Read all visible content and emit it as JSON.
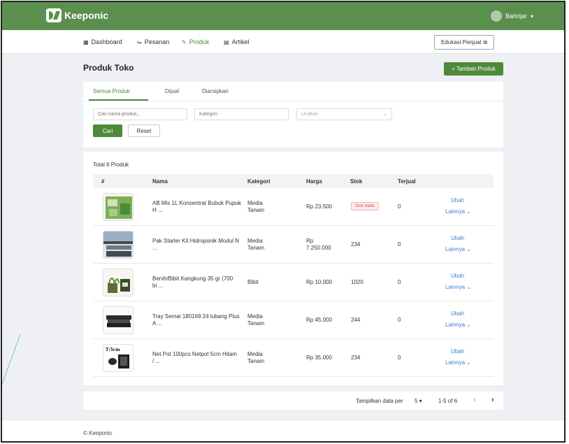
{
  "app": {
    "brand": "Keeponic",
    "user_name": "Bahrijar",
    "user_caret": "▾"
  },
  "nav": {
    "items": [
      {
        "label": "Dashboard",
        "icon": "dashboard-icon",
        "glyph": "▦"
      },
      {
        "label": "Pesanan",
        "icon": "orders-icon",
        "glyph": "⇋"
      },
      {
        "label": "Produk",
        "icon": "pencil-icon",
        "glyph": "✎"
      },
      {
        "label": "Artikel",
        "icon": "article-icon",
        "glyph": "▤"
      }
    ],
    "education_button": "Edukasi Penjual",
    "external_glyph": "⧉"
  },
  "page": {
    "title": "Produk Toko",
    "add_button": "+ Tambah Produk"
  },
  "tabs": [
    "Semua Produk",
    "Dijual",
    "Diarsipkan"
  ],
  "filters": {
    "search_placeholder": "Cari nama produk...",
    "category_placeholder": "Kategori",
    "sort_placeholder": "Urutkan",
    "sort_caret": "⌄",
    "search_button": "Cari",
    "reset_button": "Reset"
  },
  "table": {
    "total_label": "Total 6 Produk",
    "headers": [
      "#",
      "Nama",
      "Kategori",
      "Harga",
      "Stok",
      "Terjual"
    ],
    "rows": [
      {
        "name_1": "AB Mix 1L Konsentrat Bubuk Pupuk",
        "name_2": "H ...",
        "cat_1": "Media",
        "cat_2": "Tanam",
        "price_1": "Rp 23.500",
        "price_2": "",
        "stock": "",
        "badge": "Stok habis",
        "sold": "0",
        "edit": "Ubah",
        "more": "Lainnya ⌄"
      },
      {
        "name_1": "Pak Starter Kit Hidroponik Modul N",
        "name_2": "...",
        "cat_1": "Media",
        "cat_2": "Tanam",
        "price_1": "Rp",
        "price_2": "7.250.000",
        "stock": "234",
        "badge": "",
        "sold": "0",
        "edit": "Ubah",
        "more": "Lainnya ⌄"
      },
      {
        "name_1": "Benih/Bibit Kangkung 35 gr (700",
        "name_2": "bi ...",
        "cat_1": "Bibit",
        "cat_2": "",
        "price_1": "Rp 10.000",
        "price_2": "",
        "stock": "1020",
        "badge": "",
        "sold": "0",
        "edit": "Ubah",
        "more": "Lainnya ⌄"
      },
      {
        "name_1": "Tray Semai 180169 24 lubang Plus",
        "name_2": "A ...",
        "cat_1": "Media",
        "cat_2": "Tanam",
        "price_1": "Rp 45.000",
        "price_2": "",
        "stock": "244",
        "badge": "",
        "sold": "0",
        "edit": "Ubah",
        "more": "Lainnya ⌄"
      },
      {
        "name_1": "Net Pot 100pcs Netpot 5cm Hitam",
        "name_2": "/ ...",
        "cat_1": "Media",
        "cat_2": "Tanam",
        "price_1": "Rp 35.000",
        "price_2": "",
        "stock": "234",
        "badge": "",
        "sold": "0",
        "edit": "Ubah",
        "more": "Lainnya ⌄"
      }
    ],
    "thumb_labels": [
      "",
      "",
      "",
      "",
      "T:5cm"
    ]
  },
  "pagination": {
    "per_page_label": "Tampilkan data per",
    "per_page_value": "5 ▾",
    "range": "1-5 of 6",
    "prev": "‹",
    "next": "›"
  },
  "footer": {
    "text": "© Keeponic"
  },
  "colors": {
    "primary": "#4d8b3a",
    "topbar": "#5a8f4e",
    "link": "#3d7fd1",
    "danger": "#d9534f"
  }
}
